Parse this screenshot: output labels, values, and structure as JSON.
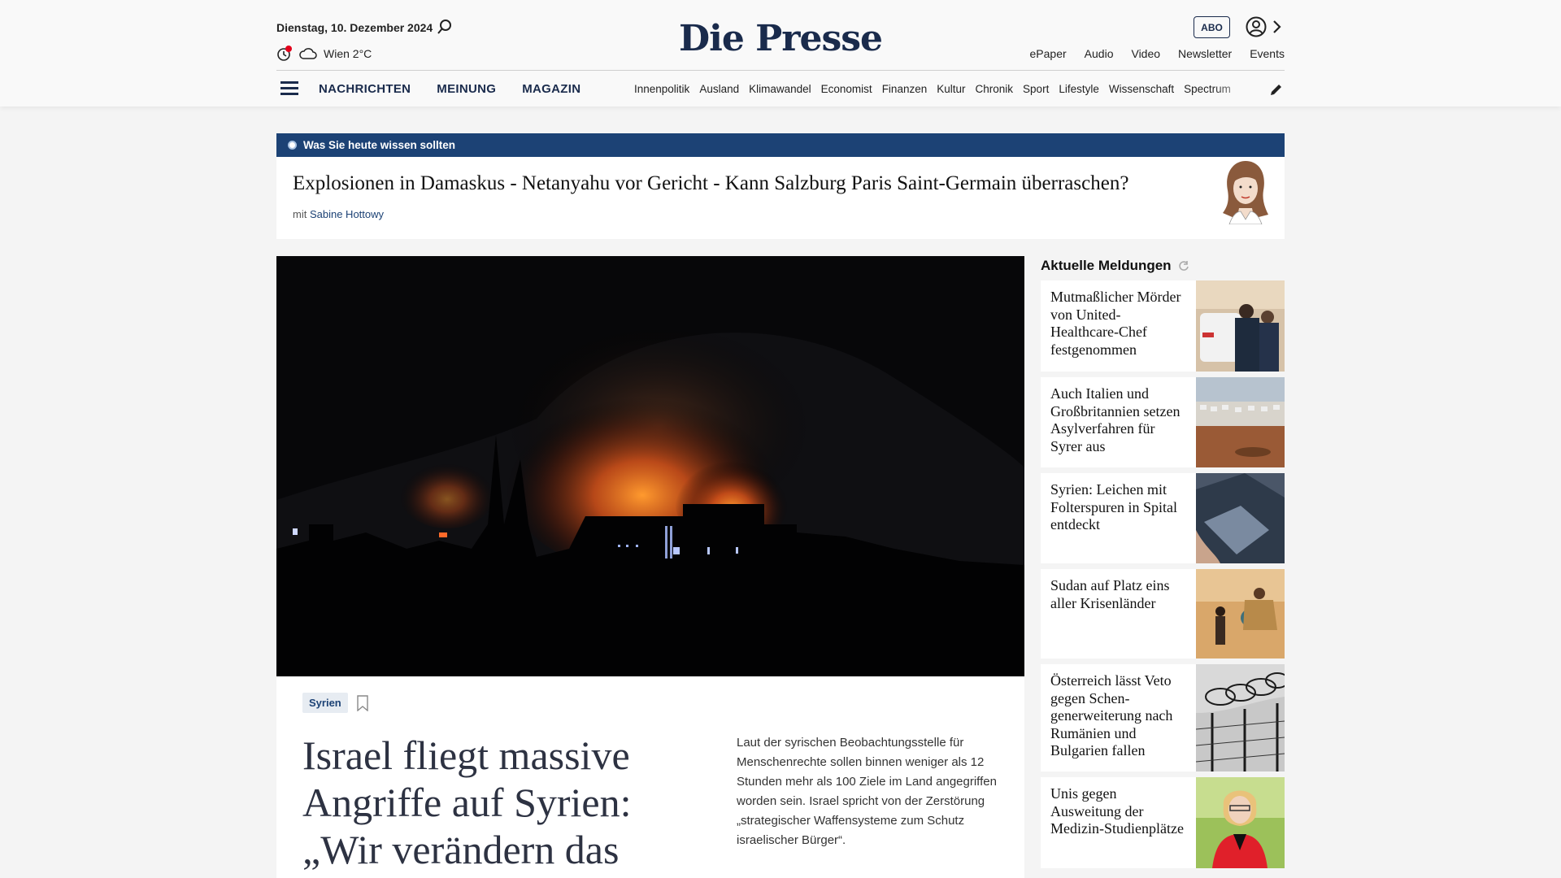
{
  "header": {
    "date": "Dienstag, 10. Dezember 2024",
    "weather": "Wien 2°C",
    "logo": "Die Presse",
    "abo_label": "ABO",
    "top_links": [
      "ePaper",
      "Audio",
      "Video",
      "Newsletter",
      "Events"
    ],
    "main_nav": [
      "NACHRICHTEN",
      "MEINUNG",
      "MAGAZIN"
    ],
    "sub_nav": [
      "Innenpolitik",
      "Ausland",
      "Klimawandel",
      "Economist",
      "Finanzen",
      "Kultur",
      "Chronik",
      "Sport",
      "Lifestyle",
      "Wissenschaft",
      "Spectrum"
    ]
  },
  "briefing": {
    "label": "Was Sie heute wissen sollten",
    "title": "Explosionen in Damaskus - Netanyahu vor Gericht - Kann Salzburg Paris Saint-Germain überraschen?",
    "by_prefix": "mit",
    "author": "Sabine Hottowy"
  },
  "lead": {
    "tag": "Syrien",
    "headline": "Israel fliegt massive Angriffe auf Syrien: „Wir verändern das Gesicht",
    "teaser": "Laut der syrischen Beobachtungsstelle für Menschenrechte sollen binnen weniger als 12 Stunden mehr als 100 Ziele im Land angegriffen worden sein. Israel spricht von der Zerstörung „strategischer Waffensysteme zum Schutz israelischer Bürger“."
  },
  "sidebar": {
    "title": "Aktuelle Meldungen",
    "items": [
      {
        "text": "Mutmaßlicher Mörder von United-Healthcare-Chef festgenommen"
      },
      {
        "text": "Auch Italien und Großbritannien setzen Asylverfahren für Syrer aus"
      },
      {
        "text": "Syrien: Leichen mit Folterspuren in Spital entdeckt"
      },
      {
        "text": "Sudan auf Platz eins aller Krisenländer"
      },
      {
        "text": "Österreich lässt Veto gegen Schen-generweiterung nach Rumänien und Bulgarien fallen"
      },
      {
        "text": "Unis gegen Ausweitung der Medizin-Studienplätze"
      }
    ]
  },
  "colors": {
    "brand": "#1a2b4c",
    "accent_bar": "#1c4275",
    "alert_dot": "#e3001b"
  }
}
